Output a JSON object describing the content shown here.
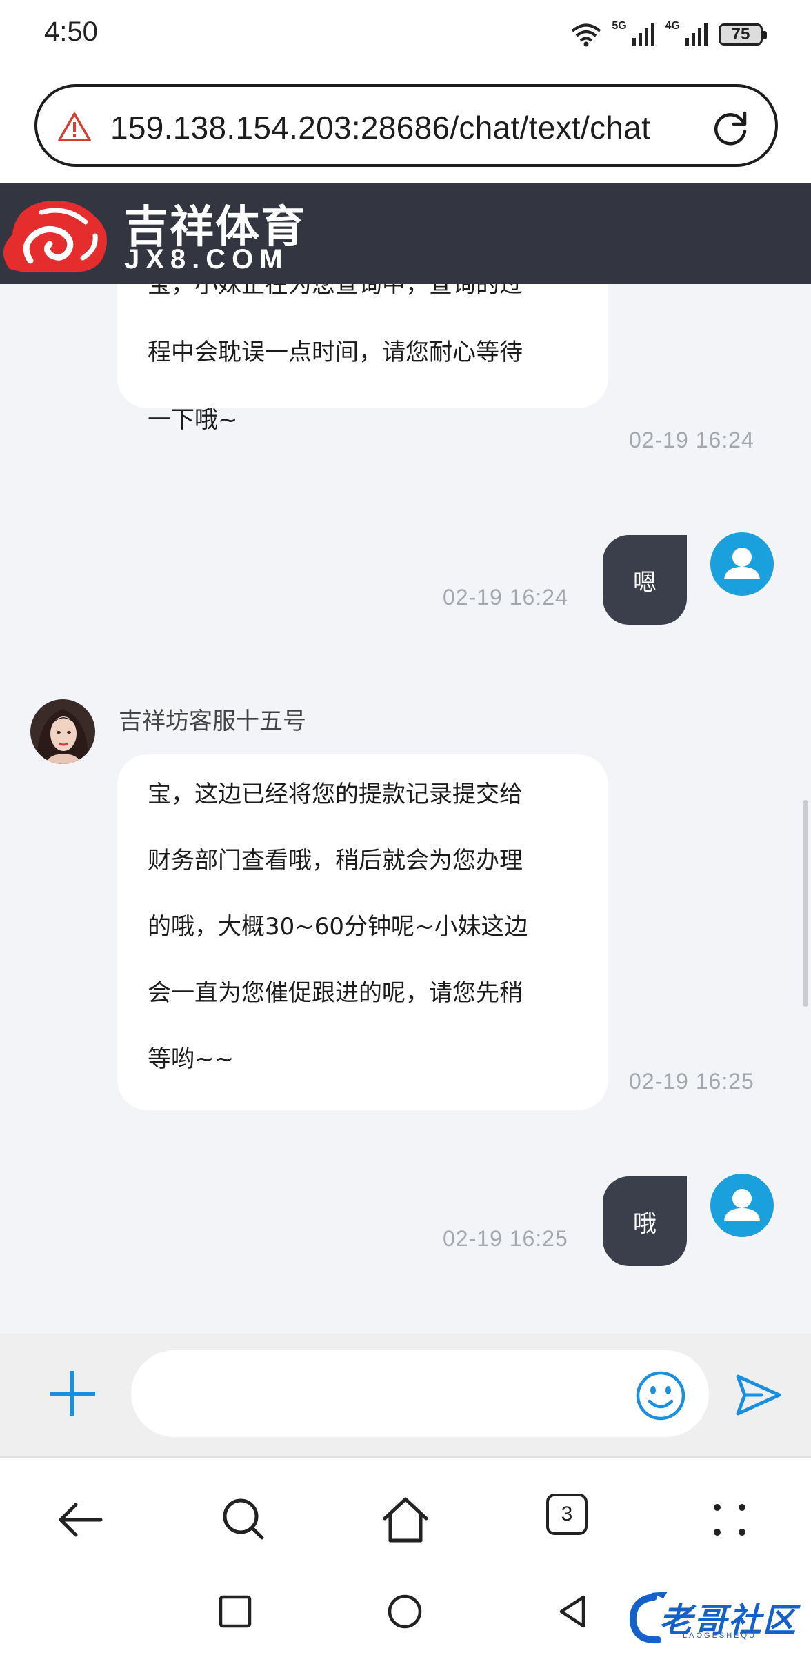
{
  "status_bar": {
    "time": "4:50",
    "network_1": "5G",
    "network_2": "4G",
    "battery": "75"
  },
  "address_bar": {
    "url": "159.138.154.203:28686/chat/text/chat",
    "warning_icon": "warning-triangle-icon",
    "reload_icon": "reload-icon"
  },
  "site": {
    "name_cn": "吉祥体育",
    "name_en": "JX8.COM",
    "brand_color": "#e52d2d",
    "header_bg": "#333641"
  },
  "chat": {
    "messages": [
      {
        "direction": "incoming",
        "lines": [
          "宝，小妹正在为您查询中，查询的过",
          "程中会耽误一点时间，请您耐心等待",
          "一下哦~"
        ],
        "time": "02-19 16:24"
      },
      {
        "direction": "outgoing",
        "text": "嗯",
        "time": "02-19 16:24"
      },
      {
        "direction": "incoming",
        "sender": "吉祥坊客服十五号",
        "lines": [
          "宝，这边已经将您的提款记录提交给",
          "财务部门查看哦，稍后就会为您办理",
          "的哦，大概30~60分钟呢~小妹这边",
          "会一直为您催促跟进的呢，请您先稍",
          "等哟~~"
        ],
        "time": "02-19 16:25"
      },
      {
        "direction": "outgoing",
        "text": "哦",
        "time": "02-19 16:25"
      }
    ]
  },
  "composer": {
    "placeholder": "",
    "plus_icon": "plus-icon",
    "emoji_icon": "smiley-icon",
    "send_icon": "send-icon",
    "accent_color": "#1a8fe0"
  },
  "browser_toolbar": {
    "tab_count": "3",
    "icons": [
      "back-arrow-icon",
      "search-icon",
      "home-icon",
      "tabs-icon",
      "more-icon"
    ]
  },
  "system_nav": {
    "icons": [
      "recents-square-icon",
      "home-circle-icon",
      "back-triangle-icon"
    ],
    "watermark": "老哥社区",
    "watermark_sub": "LAOGESHEQU"
  }
}
